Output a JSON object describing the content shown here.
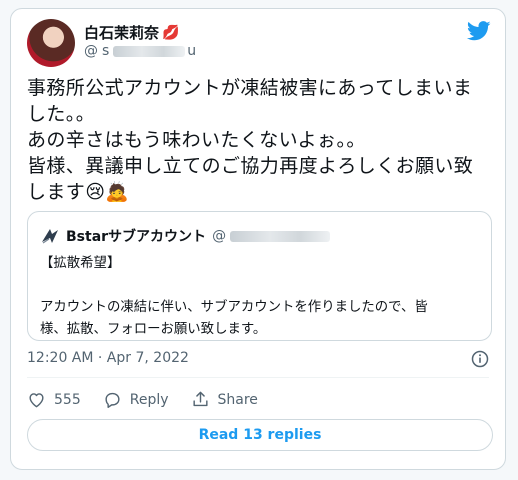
{
  "tweet": {
    "author": {
      "display_name": "白石茉莉奈",
      "name_emoji": "💋",
      "handle_prefix": "@",
      "handle_visible": "s",
      "handle_suffix": "u"
    },
    "brand_icon": "twitter-bird-icon",
    "text": "事務所公式アカウントが凍結被害にあってしまいま\nした。。\nあの辛さはもう味わいたくないよぉ。。\n皆様、異議申し立てのご協力再度よろしくお願い致\nします😢🙇",
    "quote": {
      "avatar_icon": "bstar-logo-icon",
      "name": "Bstarサブアカウント",
      "handle_prefix": "@",
      "heading": "【拡散希望】",
      "body": "アカウントの凍結に伴い、サブアカウントを作りましたので、皆\n様、拡散、フォローお願い致します。"
    },
    "timestamp": "12:20 AM · Apr 7, 2022",
    "likes": "555",
    "reply_label": "Reply",
    "share_label": "Share",
    "read_replies_label": "Read 13 replies"
  },
  "colors": {
    "accent": "#1d9bf0",
    "text": "#0f1419",
    "muted": "#536471",
    "border": "#cfd9de"
  }
}
